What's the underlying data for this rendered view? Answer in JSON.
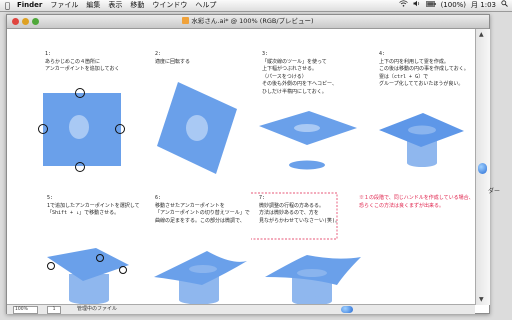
{
  "menubar": {
    "apple": "",
    "items": [
      "Finder",
      "ファイル",
      "編集",
      "表示",
      "移動",
      "ウインドウ",
      "ヘルプ"
    ],
    "battery": "(100%)",
    "clock": "月 1:03"
  },
  "window": {
    "title": "水彩さん.ai* @ 100% (RGB/プレビュー)"
  },
  "steps": {
    "s1": [
      "1:",
      "あらかじめこの４箇所に",
      "アンカーポイントを追加しておく"
    ],
    "s2": [
      "2:",
      "適度に回転する"
    ],
    "s3": [
      "3:",
      "「縦次線のツール」を使って",
      "上下幅がつぶれさせる。",
      "（パースをつける）",
      "その後も外側の円を下へコピー、",
      "ひしだけ半楕円にしておく。"
    ],
    "s4": [
      "4:",
      "上下の円を利用して霊を作成。",
      "この後は移動の円の事を作成しておく。",
      "霊は〔ctrl + G〕で",
      "グループ化してておいたほうが良い。"
    ],
    "s5": [
      "5:",
      "1で追加したアンカーポイントを選択して",
      "「Shift + ↓」で移動させる。"
    ],
    "s6": [
      "6:",
      "移動させたアンカーポイントを",
      "「アンカーポイントの切り替えツール」で",
      "曲線の足まをする。この部分は微調で、"
    ],
    "s7": [
      "7:",
      "微妙調整の行程の方あるる。",
      "方法は微妙あるので、方を",
      "見ながらかわせていなさーい(笑)。"
    ],
    "note": [
      "※１の段階で、同じハンドルを作成している場合、",
      "恐らくこの方法は良くまずが出来る。"
    ]
  },
  "statusbar": {
    "zoom": "100%",
    "page": "1",
    "text": "管理中のファイル"
  },
  "side_label": "ダー"
}
